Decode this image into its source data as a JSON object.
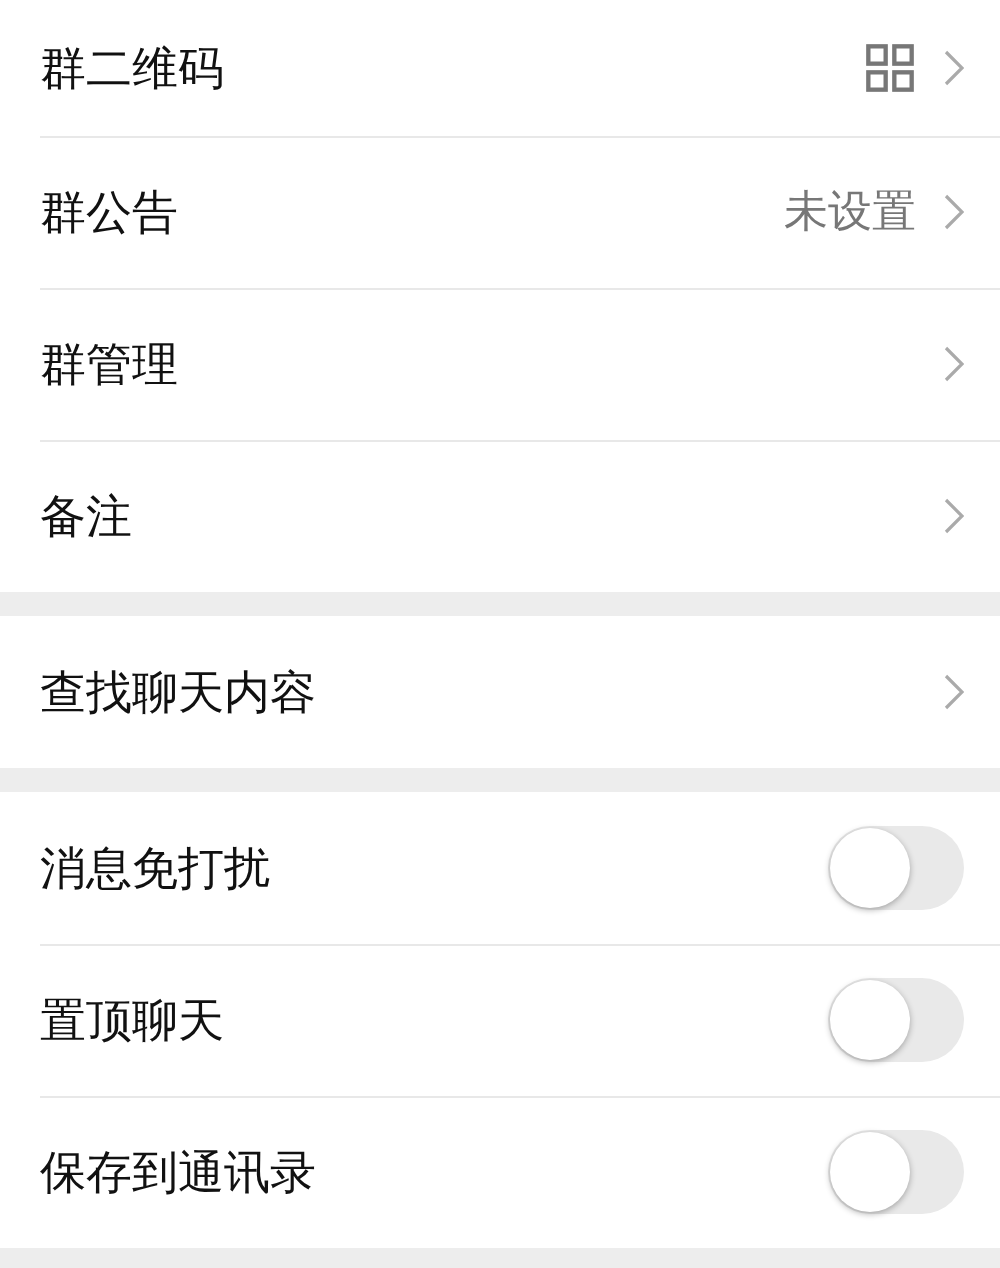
{
  "sections": [
    {
      "items": [
        {
          "kind": "qr",
          "label": "群二维码"
        },
        {
          "kind": "link",
          "label": "群公告",
          "value": "未设置"
        },
        {
          "kind": "link",
          "label": "群管理"
        },
        {
          "kind": "link",
          "label": "备注"
        }
      ]
    },
    {
      "items": [
        {
          "kind": "link",
          "label": "查找聊天内容"
        }
      ]
    },
    {
      "items": [
        {
          "kind": "toggle",
          "label": "消息免打扰",
          "on": false
        },
        {
          "kind": "toggle",
          "label": "置顶聊天",
          "on": false
        },
        {
          "kind": "toggle",
          "label": "保存到通讯录",
          "on": false
        }
      ]
    }
  ]
}
